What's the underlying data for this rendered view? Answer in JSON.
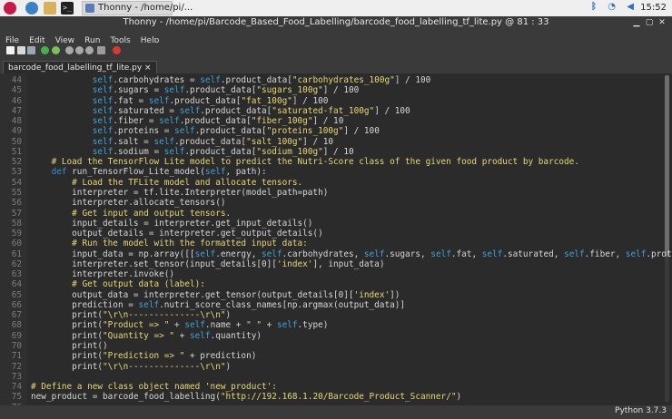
{
  "taskbar": {
    "icons": [
      "raspberry-pi-menu-icon",
      "web-browser-icon",
      "file-manager-icon",
      "terminal-icon"
    ],
    "task_label": "Thonny - /home/pi/...",
    "tray": {
      "bluetooth": "bluetooth-icon",
      "wifi": "wifi-icon",
      "volume": "volume-icon",
      "clock": "15:52"
    }
  },
  "window": {
    "title": "Thonny - /home/pi/Barcode_Based_Food_Labelling/barcode_food_labelling_tf_lite.py @ 81 : 33"
  },
  "menu": [
    "File",
    "Edit",
    "View",
    "Run",
    "Tools",
    "Help"
  ],
  "toolbar": [
    "new-file-icon",
    "open-file-icon",
    "save-file-icon",
    "run-icon",
    "debug-icon",
    "step-over-icon",
    "step-into-icon",
    "step-out-icon",
    "resume-icon",
    "stop-icon"
  ],
  "tab": {
    "label": "barcode_food_labelling_tf_lite.py ×"
  },
  "editor": {
    "lines": [
      {
        "n": "44",
        "text": "            self.carbohydrates = self.product_data[\"carbohydrates_100g\"] / 100"
      },
      {
        "n": "45",
        "text": "            self.sugars = self.product_data[\"sugars_100g\"] / 100"
      },
      {
        "n": "46",
        "text": "            self.fat = self.product_data[\"fat_100g\"] / 100"
      },
      {
        "n": "47",
        "text": "            self.saturated = self.product_data[\"saturated-fat_100g\"] / 100"
      },
      {
        "n": "48",
        "text": "            self.fiber = self.product_data[\"fiber_100g\"] / 10"
      },
      {
        "n": "49",
        "text": "            self.proteins = self.product_data[\"proteins_100g\"] / 100"
      },
      {
        "n": "50",
        "text": "            self.salt = self.product_data[\"salt_100g\"] / 10"
      },
      {
        "n": "51",
        "text": "            self.sodium = self.product_data[\"sodium_100g\"] / 10"
      },
      {
        "n": "52",
        "text": "    # Load the TensorFlow Lite model to predict the Nutri-Score class of the given food product by barcode."
      },
      {
        "n": "53",
        "text": "    def run_TensorFlow_Lite_model(self, path):"
      },
      {
        "n": "54",
        "text": "        # Load the TFLite model and allocate tensors."
      },
      {
        "n": "55",
        "text": "        interpreter = tf.lite.Interpreter(model_path=path)"
      },
      {
        "n": "56",
        "text": "        interpreter.allocate_tensors()"
      },
      {
        "n": "57",
        "text": "        # Get input and output tensors."
      },
      {
        "n": "58",
        "text": "        input_details = interpreter.get_input_details()"
      },
      {
        "n": "59",
        "text": "        output_details = interpreter.get_output_details()"
      },
      {
        "n": "60",
        "text": "        # Run the model with the formatted input data:"
      },
      {
        "n": "61",
        "text": "        input_data = np.array([[self.energy, self.carbohydrates, self.sugars, self.fat, self.saturated, self.fiber, self.proteins, self.sal"
      },
      {
        "n": "62",
        "text": "        interpreter.set_tensor(input_details[0]['index'], input_data)"
      },
      {
        "n": "63",
        "text": "        interpreter.invoke()"
      },
      {
        "n": "64",
        "text": "        # Get output data (label):"
      },
      {
        "n": "65",
        "text": "        output_data = interpreter.get_tensor(output_details[0]['index'])"
      },
      {
        "n": "66",
        "text": "        prediction = self.nutri_score_class_names[np.argmax(output_data)]"
      },
      {
        "n": "67",
        "text": "        print(\"\\r\\n--------------\\r\\n\")"
      },
      {
        "n": "68",
        "text": "        print(\"Product => \" + self.name + \" \" + self.type)"
      },
      {
        "n": "69",
        "text": "        print(\"Quantity => \" + self.quantity)"
      },
      {
        "n": "70",
        "text": "        print()"
      },
      {
        "n": "71",
        "text": "        print(\"Prediction => \" + prediction)"
      },
      {
        "n": "72",
        "text": "        print(\"\\r\\n--------------\\r\\n\")"
      },
      {
        "n": "73",
        "text": ""
      },
      {
        "n": "74",
        "text": "# Define a new class object named 'new_product':"
      },
      {
        "n": "75",
        "text": "new_product = barcode_food_labelling(\"http://192.168.1.20/Barcode_Product_Scanner/\")"
      },
      {
        "n": "76",
        "text": ""
      }
    ]
  },
  "statusbar": {
    "version": "Python 3.7.3"
  },
  "colors": {
    "editor_bg": "#2b2b2b",
    "keyword": "#2f93dd",
    "string": "#e6d774",
    "comment": "#e6d774",
    "text": "#d6d6d6",
    "line_number": "#7c7c7c"
  }
}
